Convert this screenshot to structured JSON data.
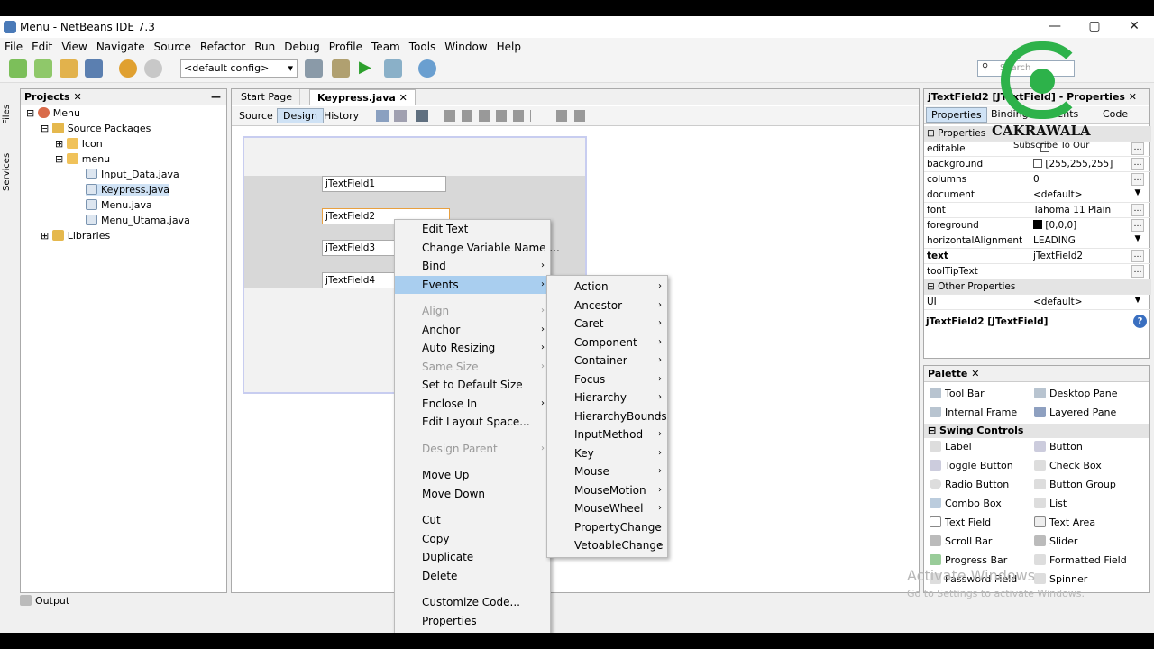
{
  "window": {
    "title": "Menu - NetBeans IDE 7.3",
    "minimize": "—",
    "maximize": "▢",
    "close": "✕"
  },
  "menubar": [
    "File",
    "Edit",
    "View",
    "Navigate",
    "Source",
    "Refactor",
    "Run",
    "Debug",
    "Profile",
    "Team",
    "Tools",
    "Window",
    "Help"
  ],
  "toolbar": {
    "config": "<default config>",
    "search_placeholder": "Search"
  },
  "side_tabs": [
    "Files",
    "Services"
  ],
  "projects": {
    "title": "Projects",
    "tree": [
      "Menu",
      "Source Packages",
      "Icon",
      "menu",
      "Input_Data.java",
      "Keypress.java",
      "Menu.java",
      "Menu_Utama.java",
      "Libraries"
    ]
  },
  "editor": {
    "tabs": [
      "Start Page",
      "Keypress.java"
    ],
    "subtabs": [
      "Source",
      "Design",
      "History"
    ]
  },
  "form": {
    "fields": [
      "jTextField1",
      "jTextField2",
      "jTextField3",
      "jTextField4"
    ]
  },
  "context_menu": [
    "Edit Text",
    "Change Variable Name ...",
    "Bind",
    "Events",
    "",
    "Align",
    "Anchor",
    "Auto Resizing",
    "Same Size",
    "Set to Default Size",
    "Enclose In",
    "Edit Layout Space...",
    "",
    "Design Parent",
    "",
    "Move Up",
    "Move Down",
    "",
    "Cut",
    "Copy",
    "Duplicate",
    "Delete",
    "",
    "Customize Code...",
    "Properties"
  ],
  "events_menu": [
    "Action",
    "Ancestor",
    "Caret",
    "Component",
    "Container",
    "Focus",
    "Hierarchy",
    "HierarchyBounds",
    "InputMethod",
    "Key",
    "Mouse",
    "MouseMotion",
    "MouseWheel",
    "PropertyChange",
    "VetoableChange"
  ],
  "properties": {
    "title": "jTextField2 [JTextField] - Properties",
    "tabs": [
      "Properties",
      "Binding",
      "Events",
      "Code"
    ],
    "section1": "Properties",
    "rows": [
      [
        "editable",
        ""
      ],
      [
        "background",
        "[255,255,255]"
      ],
      [
        "columns",
        "0"
      ],
      [
        "document",
        "<default>"
      ],
      [
        "font",
        "Tahoma 11 Plain"
      ],
      [
        "foreground",
        "[0,0,0]"
      ],
      [
        "horizontalAlignment",
        "LEADING"
      ],
      [
        "text",
        "jTextField2"
      ],
      [
        "toolTipText",
        ""
      ]
    ],
    "section2": "Other Properties",
    "ui_row": [
      "UI",
      "<default>"
    ],
    "description": "jTextField2 [JTextField]"
  },
  "palette": {
    "title": "Palette",
    "section": "Swing Controls",
    "top": [
      "Tool Bar",
      "Desktop Pane",
      "Internal Frame",
      "Layered Pane"
    ],
    "items": [
      "Label",
      "Button",
      "Toggle Button",
      "Check Box",
      "Radio Button",
      "Button Group",
      "Combo Box",
      "List",
      "Text Field",
      "Text Area",
      "Scroll Bar",
      "Slider",
      "Progress Bar",
      "Formatted Field",
      "Password Field",
      "Spinner"
    ]
  },
  "output": {
    "label": "Output"
  },
  "watermark": {
    "brand": "CAKRAWALA",
    "sub": "Subscribe To Our",
    "activate1": "Activate Windows",
    "activate2": "Go to Settings to activate Windows."
  },
  "colors": {
    "accent": "#a9ceef",
    "logo_green": "#2db24a"
  }
}
